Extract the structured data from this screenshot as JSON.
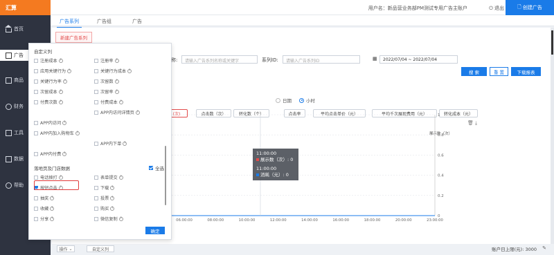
{
  "app": {
    "brand": "汇算"
  },
  "sidebar": {
    "items": [
      {
        "label": "首页",
        "icon": "home-icon"
      },
      {
        "label": "广告",
        "icon": "ad-icon"
      },
      {
        "label": "商品",
        "icon": "cart-icon"
      },
      {
        "label": "财务",
        "icon": "finance-icon"
      },
      {
        "label": "工具",
        "icon": "tool-icon"
      },
      {
        "label": "数据",
        "icon": "chart-icon"
      },
      {
        "label": "帮助",
        "icon": "help-icon"
      }
    ]
  },
  "header": {
    "user": "用户名：新品营业务部PM测试专用广告主账户",
    "logout": "退出",
    "create_ad": "创建广告"
  },
  "tabs": [
    "广告系列",
    "广告组",
    "广告"
  ],
  "toolbar": {
    "new_series": "新建广告系列"
  },
  "filters": {
    "name_label": "称:",
    "name_placeholder": "请输入广告系列名称或关键字",
    "id_label": "系列ID:",
    "id_placeholder": "请输入广告系列ID",
    "date_range": "2022/07/04  ~  2022/07/04",
    "search": "搜 索",
    "reset": "重 置",
    "download": "下载报表"
  },
  "granularity": {
    "day": "日期",
    "hour": "小时",
    "selected": "hour"
  },
  "metrics": [
    "(次)",
    "点击数（次）",
    "转化数（个）",
    "点击率",
    "平均点击单价（元）",
    "平均千次展现费用（元）",
    "转化成本（元）"
  ],
  "chart_data": {
    "type": "line",
    "x": [
      "06:00:00",
      "08:00:00",
      "10:00:00",
      "12:00:00",
      "14:00:00",
      "16:00:00",
      "18:00:00",
      "20:00:00",
      "23:00:00"
    ],
    "y_right_label": "展示数（次）",
    "y_right_ticks": [
      "1",
      "0.8",
      "0.6",
      "0.4",
      "0.2",
      "0"
    ],
    "series": [
      {
        "name": "展示数（次）",
        "color": "#e24b4b",
        "values": [
          0,
          0,
          0,
          0,
          0,
          0,
          0,
          0,
          0
        ]
      },
      {
        "name": "消耗（元）",
        "color": "#1a7be8",
        "values": [
          0,
          0,
          0,
          0,
          0,
          0,
          0,
          0,
          0
        ]
      }
    ],
    "tooltips": [
      {
        "time": "11:00:00",
        "label": "展示数（次）: 0",
        "color": "#e24b4b"
      },
      {
        "time": "11:00:00",
        "label": "消耗（元）: 0",
        "color": "#1a7be8"
      }
    ]
  },
  "bottom": {
    "action": "操作",
    "custom_cols": "自定义列",
    "limit": "账户日上限(元): 3000"
  },
  "panel": {
    "title": "自定义列",
    "items_top": [
      {
        "left": "注册成本",
        "right": "注册率"
      },
      {
        "left": "应用关键行为",
        "right": "关键行为成本"
      },
      {
        "left": "关键行为率",
        "right": "次留数"
      },
      {
        "left": "次留成本",
        "right": "次留率"
      },
      {
        "left": "付费次数",
        "right": "付费成本"
      },
      {
        "left": "",
        "right": "APP内访问详情页"
      },
      {
        "left": "APP内访问",
        "right": ""
      },
      {
        "left": "APP内加入购物车",
        "right": ""
      },
      {
        "left": "",
        "right": "APP内下单"
      },
      {
        "left": "APP内付费",
        "right": ""
      }
    ],
    "section": "落地页及门店数据",
    "select_all": "全选",
    "items_bottom": [
      {
        "left": "电话拨打",
        "right": "表单提交"
      },
      {
        "left": "按钮点击",
        "right": "下载"
      },
      {
        "left": "抽奖",
        "right": "投票"
      },
      {
        "left": "收藏",
        "right": "购买"
      },
      {
        "left": "分享",
        "right": "微信复制"
      }
    ],
    "checked": "按钮点击",
    "confirm": "确定"
  }
}
